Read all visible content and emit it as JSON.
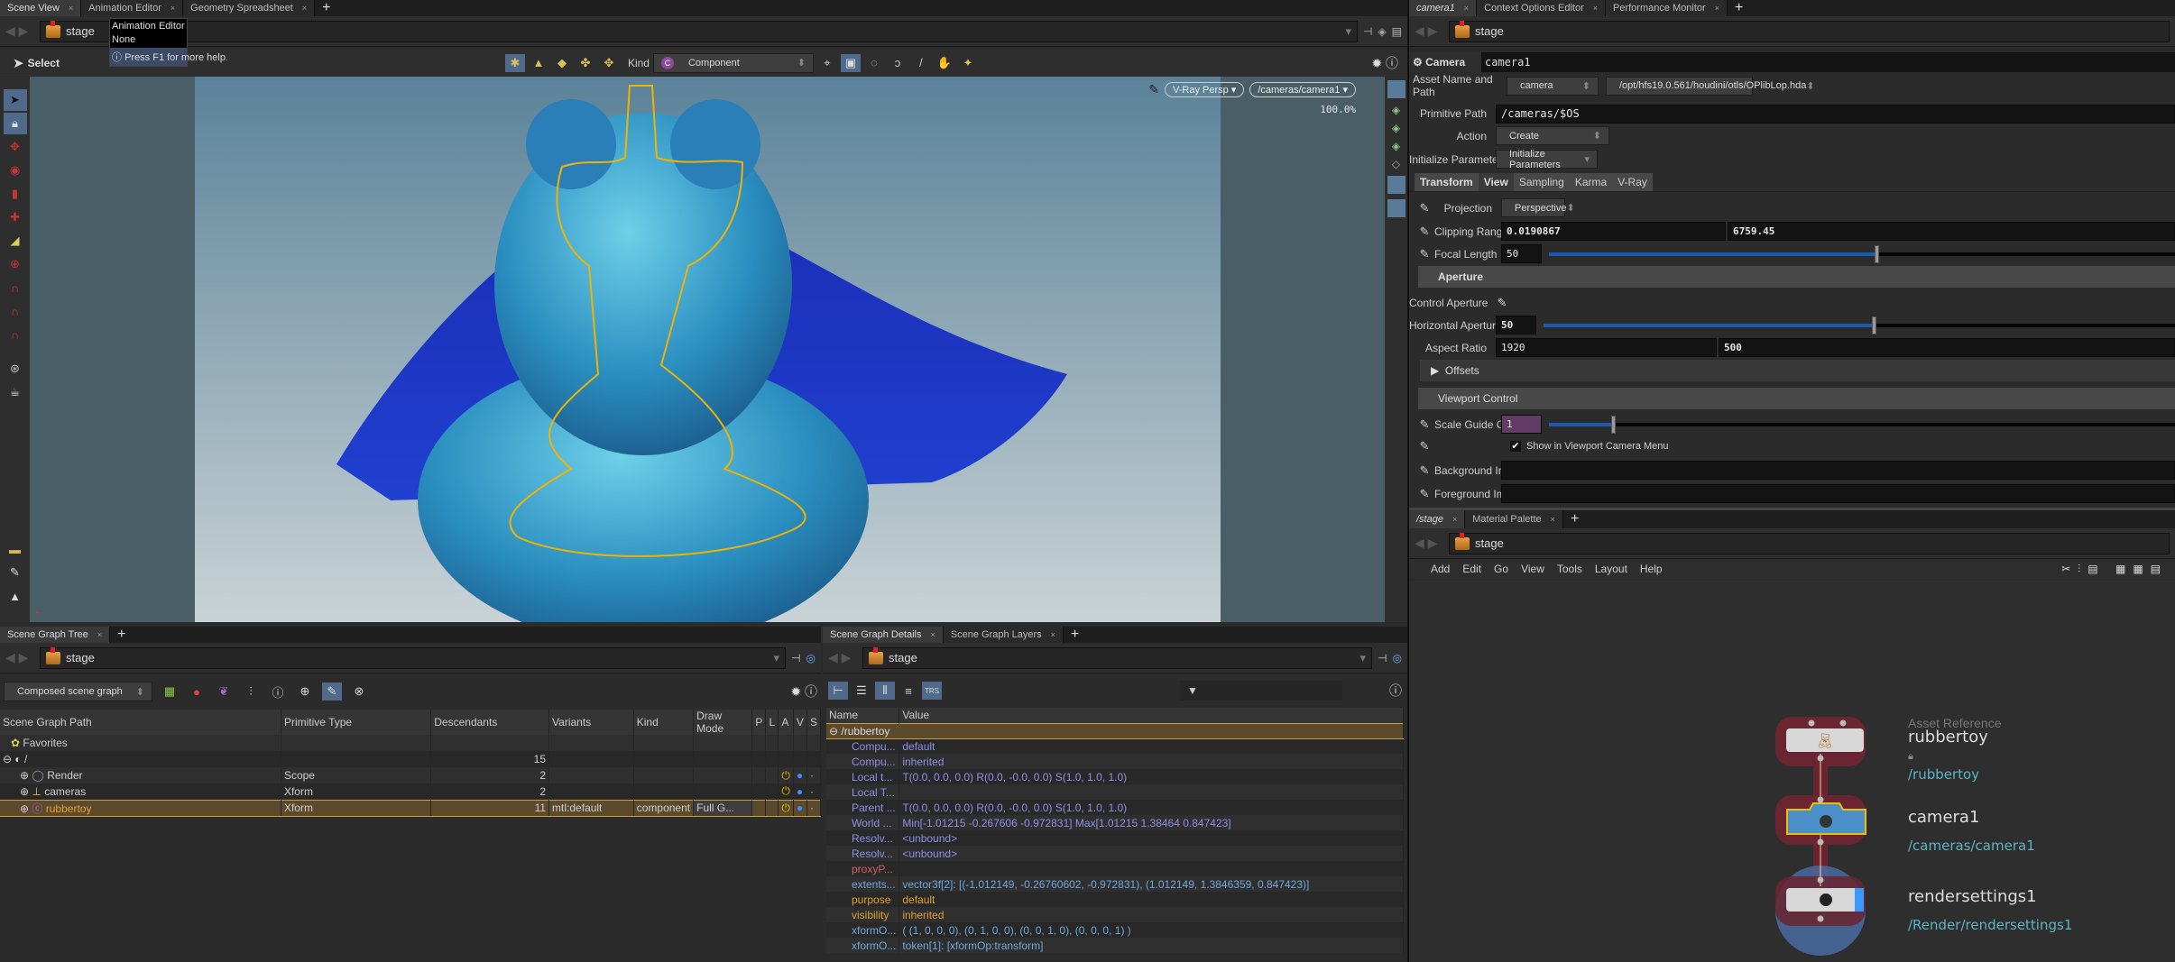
{
  "left_tabs": [
    "Scene View",
    "Animation Editor",
    "Geometry Spreadsheet"
  ],
  "path": "stage",
  "tooltip": {
    "line1": "Animation Editor",
    "line2": "None",
    "help": "Press F1 for more help."
  },
  "viewport": {
    "tool": "Select",
    "kind_label": "Kind",
    "kind_value": "Component",
    "camera_menu": "V-Ray Persp",
    "camera_path": "/cameras/camera1",
    "zoom": "100.0%"
  },
  "tree": {
    "tab": "Scene Graph Tree",
    "mode": "Composed scene graph",
    "columns": [
      "Scene Graph Path",
      "Primitive Type",
      "Descendants",
      "Variants",
      "Kind",
      "Draw Mode",
      "P",
      "L",
      "A",
      "V",
      "S"
    ],
    "rows": [
      {
        "name": "Favorites",
        "type": "",
        "desc": "",
        "variants": "",
        "kind": "",
        "draw": ""
      },
      {
        "name": "/",
        "type": "",
        "desc": "15",
        "variants": "",
        "kind": "",
        "draw": ""
      },
      {
        "name": "Render",
        "type": "Scope",
        "desc": "2",
        "variants": "",
        "kind": "",
        "draw": ""
      },
      {
        "name": "cameras",
        "type": "Xform",
        "desc": "2",
        "variants": "",
        "kind": "",
        "draw": ""
      },
      {
        "name": "rubbertoy",
        "type": "Xform",
        "desc": "11",
        "variants": "mtl:default",
        "kind": "component",
        "draw": "Full G..."
      }
    ]
  },
  "details": {
    "tabs": [
      "Scene Graph Details",
      "Scene Graph Layers"
    ],
    "columns": [
      "Name",
      "Value"
    ],
    "root": "/rubbertoy",
    "rows": [
      {
        "name": "Compu...",
        "value": "default",
        "color": "#8f8fe8"
      },
      {
        "name": "Compu...",
        "value": "inherited",
        "color": "#8f8fe8"
      },
      {
        "name": "Local t...",
        "value": "T(0.0, 0.0, 0.0) R(0.0, -0.0, 0.0) S(1.0, 1.0, 1.0)",
        "color": "#8f8fe8"
      },
      {
        "name": "Local T...",
        "value": "",
        "color": "#8f8fe8"
      },
      {
        "name": "Parent ...",
        "value": "T(0.0, 0.0, 0.0) R(0.0, -0.0, 0.0) S(1.0, 1.0, 1.0)",
        "color": "#8f8fe8"
      },
      {
        "name": "World ...",
        "value": "Min[-1.01215 -0.267606 -0.972831] Max[1.01215 1.38464 0.847423]",
        "color": "#8f8fe8"
      },
      {
        "name": "Resolv...",
        "value": "<unbound>",
        "color": "#8f8fe8"
      },
      {
        "name": "Resolv...",
        "value": "<unbound>",
        "color": "#8f8fe8"
      },
      {
        "name": "proxyP...",
        "value": "",
        "color": "#d06060"
      },
      {
        "name": "extents...",
        "value": "vector3f[2]: [(-1.012149, -0.26760602, -0.972831), (1.012149, 1.3846359, 0.847423)]",
        "color": "#6fa8dc"
      },
      {
        "name": "purpose",
        "value": "default",
        "color": "#e0a030"
      },
      {
        "name": "visibility",
        "value": "inherited",
        "color": "#e0a030"
      },
      {
        "name": "xformO...",
        "value": "( (1, 0, 0, 0), (0, 1, 0, 0), (0, 0, 1, 0), (0, 0, 0, 1) )",
        "color": "#6fa8dc"
      },
      {
        "name": "xformO...",
        "value": "token[1]: [xformOp:transform]",
        "color": "#6fa8dc"
      }
    ]
  },
  "params": {
    "tabs": [
      "camera1",
      "Context Options Editor",
      "Performance Monitor"
    ],
    "node_type": "Camera",
    "node_name": "camera1",
    "asset_label": "Asset Name and Path",
    "asset_name": "camera",
    "asset_path": "/opt/hfs19.0.561/houdini/otls/OPlibLop.hda",
    "prim_path_label": "Primitive Path",
    "prim_path": "/cameras/$OS",
    "action_label": "Action",
    "action": "Create",
    "init_label": "Initialize Parameters",
    "init": "Initialize Parameters",
    "subtabs": [
      "Transform",
      "View",
      "Sampling",
      "Karma",
      "V-Ray"
    ],
    "projection_label": "Projection",
    "projection": "Perspective",
    "clip_label": "Clipping Range",
    "clip_near": "0.0190867",
    "clip_far": "6759.45",
    "focal_label": "Focal Length",
    "focal": "50",
    "focal_slider": 0.52,
    "aperture_header": "Aperture",
    "control_aperture_label": "Control Aperture",
    "haperture_label": "Horizontal Aperture",
    "haperture": "50",
    "haperture_slider": 0.52,
    "aspect_label": "Aspect Ratio",
    "aspect_x": "1920",
    "aspect_y": "500",
    "offsets": "Offsets",
    "viewport_header": "Viewport Control",
    "scale_label": "Scale Guide Geo...",
    "scale": "1",
    "scale_slider": 0.1,
    "show_menu": "Show in Viewport Camera Menu",
    "show_menu_checked": true,
    "bg_label": "Background Image",
    "fg_label": "Foreground Image"
  },
  "network": {
    "tabs": [
      "/stage",
      "Material Palette"
    ],
    "menu": [
      "Add",
      "Edit",
      "Go",
      "View",
      "Tools",
      "Layout",
      "Help"
    ],
    "nodes": [
      {
        "type": "Asset Reference",
        "name": "rubbertoy",
        "path": "/rubbertoy"
      },
      {
        "name": "camera1",
        "path": "/cameras/camera1"
      },
      {
        "name": "rendersettings1",
        "path": "/Render/rendersettings1"
      }
    ]
  }
}
